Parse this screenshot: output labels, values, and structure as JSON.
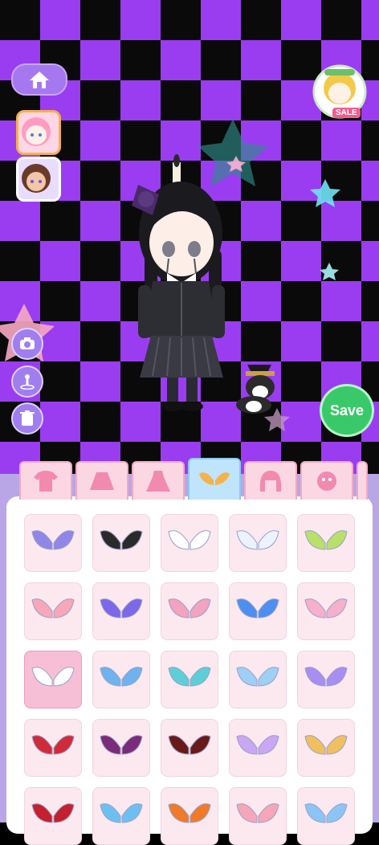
{
  "navigation": {
    "home_icon": "home-icon"
  },
  "characters": [
    {
      "name": "pink-hair-girl-avatar",
      "selected": true
    },
    {
      "name": "brown-hair-girl-avatar",
      "selected": false
    }
  ],
  "promo": {
    "badge_text": "SALE"
  },
  "tools": {
    "camera_icon": "camera-icon",
    "pose_icon": "pose-icon",
    "delete_icon": "trash-icon"
  },
  "save_button": {
    "label": "Save"
  },
  "category_tabs": [
    {
      "name": "tops",
      "icon": "shirt-icon"
    },
    {
      "name": "skirts",
      "icon": "skirt-icon"
    },
    {
      "name": "dresses",
      "icon": "dress-icon"
    },
    {
      "name": "wings",
      "icon": "wings-icon",
      "active": true
    },
    {
      "name": "hair",
      "icon": "hair-icon"
    },
    {
      "name": "faces",
      "icon": "face-icon"
    }
  ],
  "items": [
    {
      "name": "purple-feather-wings",
      "color": "#8f86e8"
    },
    {
      "name": "black-bow-wings",
      "color": "#2a2a2a"
    },
    {
      "name": "white-angel-wings",
      "color": "#ffffff"
    },
    {
      "name": "small-white-wings",
      "color": "#eaf3ff"
    },
    {
      "name": "green-fairy-wings",
      "color": "#b8e06a"
    },
    {
      "name": "pink-ribbon-bow",
      "color": "#f7a7b8"
    },
    {
      "name": "blue-butterfly-wings",
      "color": "#7c68e8"
    },
    {
      "name": "pink-mini-wings",
      "color": "#f3a2c0"
    },
    {
      "name": "blue-crystal-wings",
      "color": "#4e8ef0"
    },
    {
      "name": "pink-layered-wings",
      "color": "#f7b0cc"
    },
    {
      "name": "white-mini-wings-selected",
      "color": "#ffffff",
      "selected": true
    },
    {
      "name": "blue-ribbon-bow",
      "color": "#6fb3ee"
    },
    {
      "name": "teal-small-wings",
      "color": "#5ccfd6"
    },
    {
      "name": "blue-checked-bow",
      "color": "#9ed0f6"
    },
    {
      "name": "rainbow-fairy-wings",
      "color": "#a88ef2"
    },
    {
      "name": "red-demon-wings",
      "color": "#cf2b3b"
    },
    {
      "name": "purple-bat-wings",
      "color": "#7a2b7a"
    },
    {
      "name": "dark-red-bat-wings",
      "color": "#6a1a1a"
    },
    {
      "name": "lavender-bow",
      "color": "#c9a7f2"
    },
    {
      "name": "rainbow-feather-wings",
      "color": "#f0c060"
    },
    {
      "name": "rose-wings",
      "color": "#c42030"
    },
    {
      "name": "blue-frost-wings",
      "color": "#6cc0f0"
    },
    {
      "name": "flame-wings",
      "color": "#f07a2a"
    },
    {
      "name": "pink-white-bow",
      "color": "#f6a6b8"
    },
    {
      "name": "sky-blue-wings",
      "color": "#8cc4f6"
    }
  ]
}
